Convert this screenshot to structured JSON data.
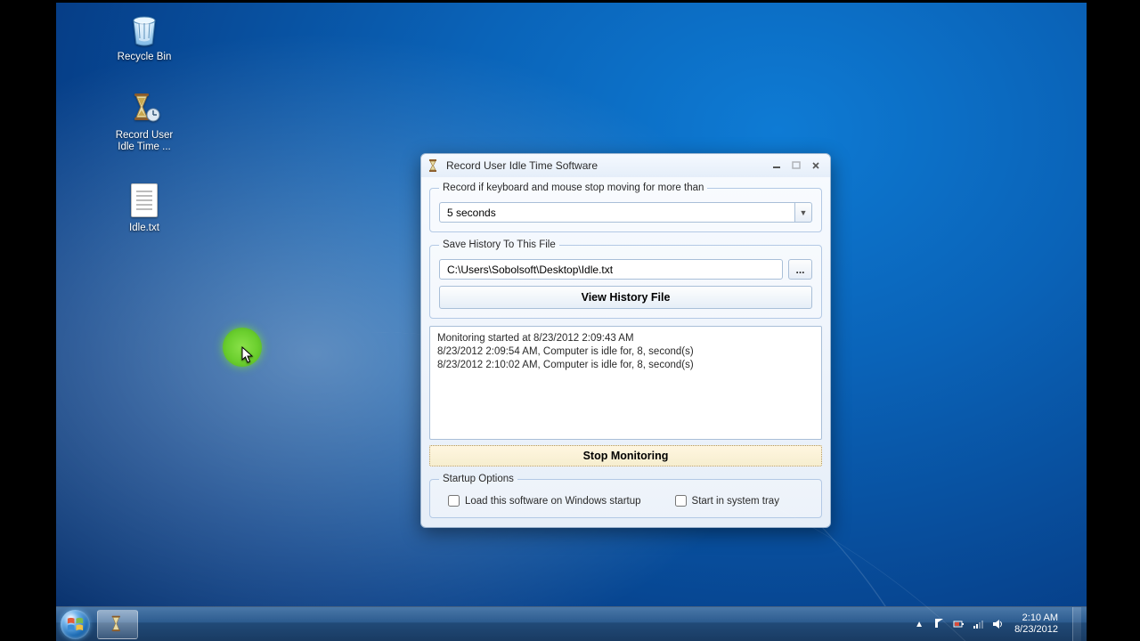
{
  "desktop": {
    "icons": {
      "recycle_bin": "Recycle Bin",
      "app_shortcut": "Record User Idle Time ...",
      "textfile": "Idle.txt"
    }
  },
  "window": {
    "title": "Record User Idle Time Software",
    "groups": {
      "threshold_legend": "Record if keyboard and mouse stop moving for more than",
      "threshold_value": "5 seconds",
      "savefile_legend": "Save History To This File",
      "savefile_path": "C:\\Users\\Sobolsoft\\Desktop\\Idle.txt",
      "browse_label": "...",
      "view_history_label": "View History File",
      "startup_legend": "Startup Options",
      "startup_load_label": "Load this software on Windows startup",
      "startup_tray_label": "Start in system tray"
    },
    "log_lines": [
      "Monitoring started at 8/23/2012 2:09:43 AM",
      "8/23/2012 2:09:54 AM, Computer is idle for, 8, second(s)",
      "8/23/2012 2:10:02 AM, Computer is idle for, 8, second(s)"
    ],
    "stop_label": "Stop Monitoring"
  },
  "taskbar": {
    "clock_time": "2:10 AM",
    "clock_date": "8/23/2012"
  }
}
